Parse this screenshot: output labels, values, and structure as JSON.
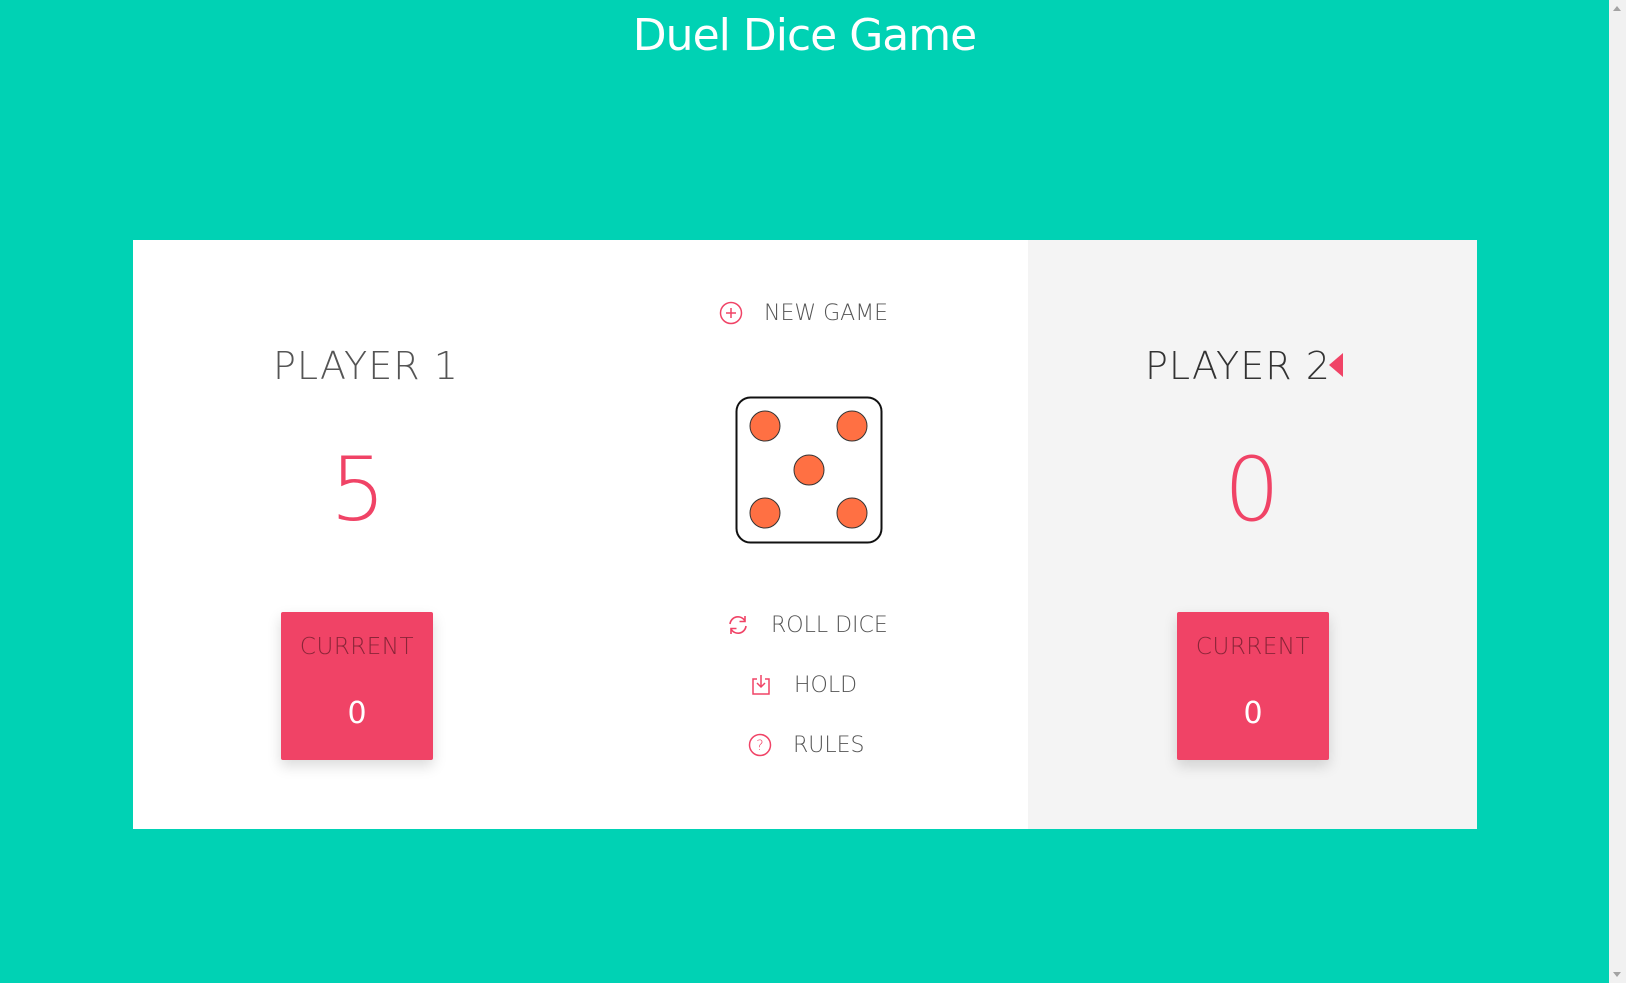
{
  "title": "Duel Dice Game",
  "players": [
    {
      "name": "PLAYER 1",
      "score": "5",
      "current_label": "CURRENT",
      "current_value": "0",
      "active": false
    },
    {
      "name": "PLAYER 2",
      "score": "0",
      "current_label": "CURRENT",
      "current_value": "0",
      "active": true
    }
  ],
  "controls": {
    "new_game": "NEW GAME",
    "roll_dice": "ROLL DICE",
    "hold": "HOLD",
    "rules": "RULES"
  },
  "dice": {
    "value": 5,
    "pip_color": "#ff7043"
  },
  "colors": {
    "background": "#00d2b4",
    "accent": "#f04366",
    "active_panel": "#f4f4f4"
  },
  "icons": {
    "new_game": "plus-circle-icon",
    "roll_dice": "refresh-icon",
    "hold": "download-icon",
    "rules": "question-circle-icon",
    "active": "caret-left-icon"
  }
}
